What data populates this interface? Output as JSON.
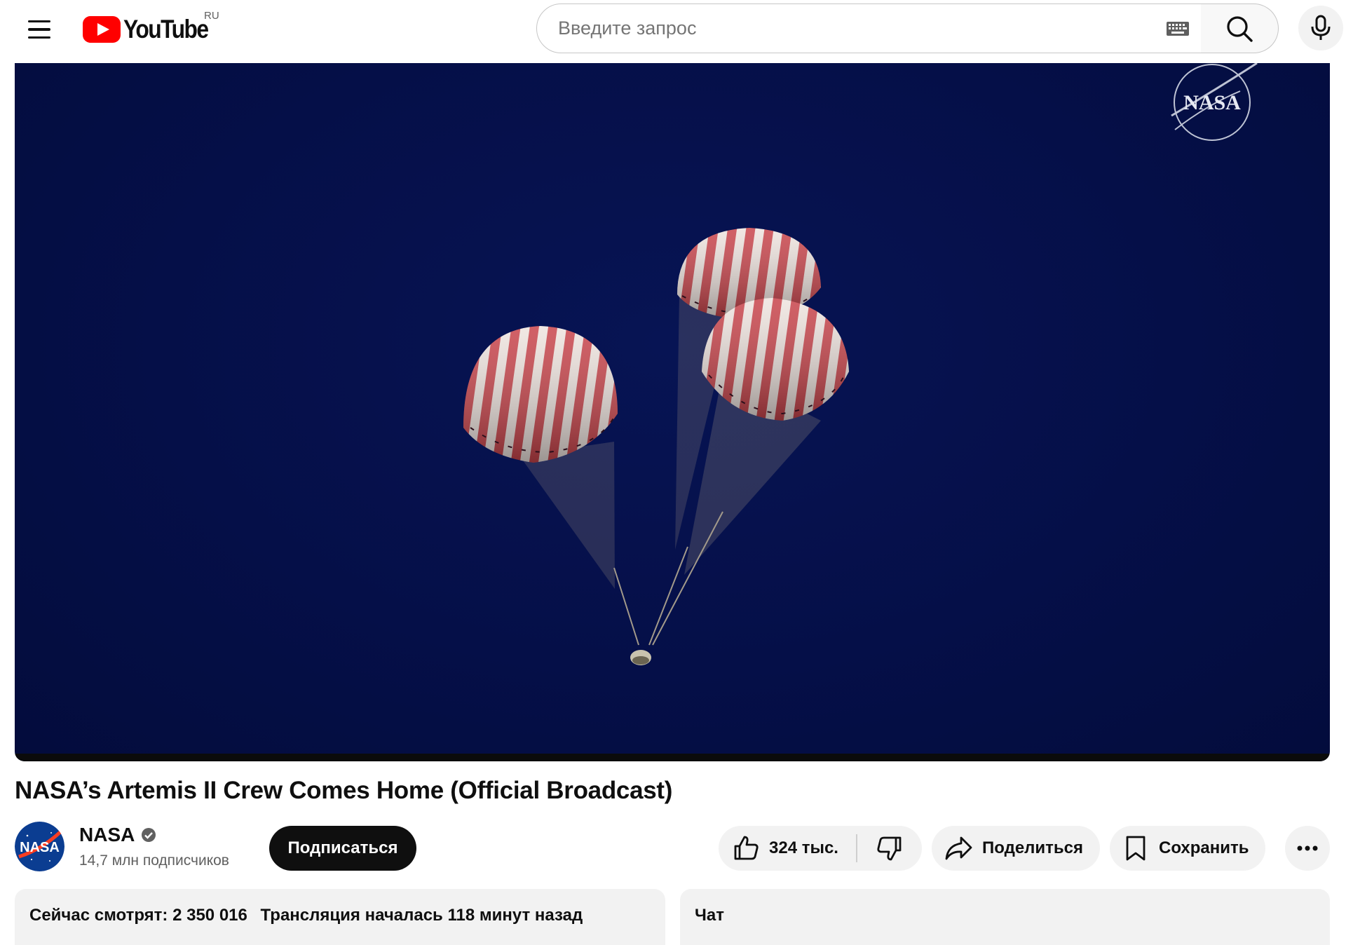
{
  "header": {
    "logo_text": "YouTube",
    "country_code": "RU",
    "search_placeholder": "Введите запрос"
  },
  "player": {
    "watermark": "NASA"
  },
  "video": {
    "title": "NASA’s Artemis II Crew Comes Home (Official Broadcast)"
  },
  "owner": {
    "channel_name": "NASA",
    "subscribers": "14,7 млн подписчиков",
    "avatar_text": "NASA",
    "subscribe_label": "Подписаться"
  },
  "actions": {
    "like_count": "324 тыс.",
    "share_label": "Поделиться",
    "save_label": "Сохранить"
  },
  "info": {
    "watching_now": "Сейчас смотрят: 2 350 016",
    "started": "Трансляция началась 118 минут назад"
  },
  "chat": {
    "title": "Чат"
  },
  "colors": {
    "brand_red": "#ff0000",
    "video_bg": "#050f48",
    "subscribe_bg": "#0f0f0f",
    "chip_bg": "#f2f2f2"
  }
}
